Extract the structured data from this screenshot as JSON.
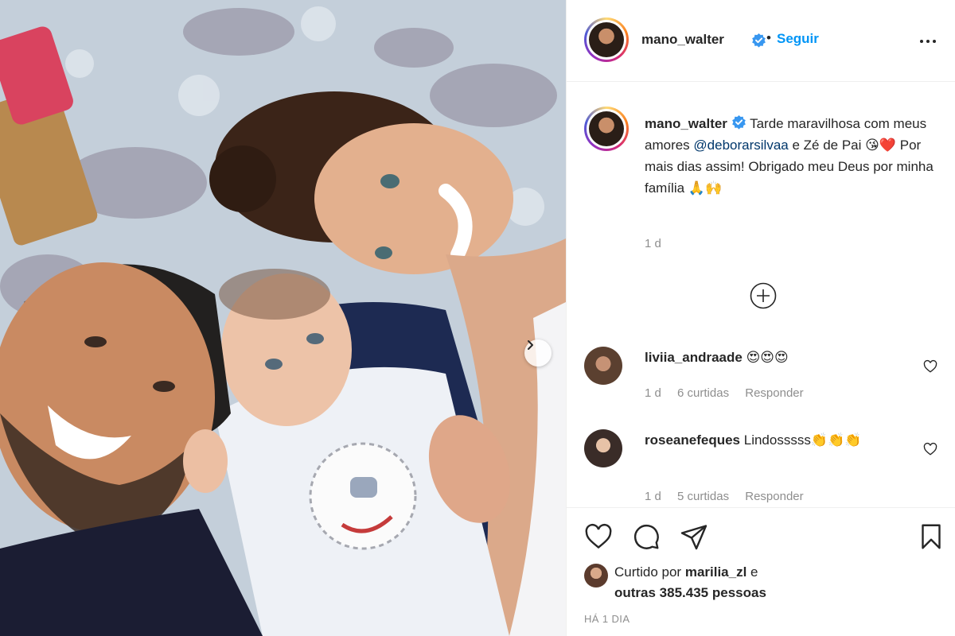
{
  "header": {
    "username": "mano_walter",
    "separator": "•",
    "follow_label": "Seguir",
    "more_icon": "more-horizontal-icon"
  },
  "caption": {
    "username": "mano_walter",
    "text_before_mention": "Tarde maravilhosa com meus amores ",
    "mention": "@deborarsilvaa",
    "text_after_mention": " e Zé de Pai 😘❤️ Por mais dias assim! Obrigado meu Deus por minha família 🙏🙌",
    "time": "1 d"
  },
  "load_more_icon": "plus-circle-icon",
  "comments": [
    {
      "username": "liviia_andraade",
      "text": "😍😍😍",
      "time": "1 d",
      "likes": "6 curtidas",
      "reply_label": "Responder"
    },
    {
      "username": "roseanefeques",
      "text": "Lindosssss👏👏👏",
      "time": "1 d",
      "likes": "5 curtidas",
      "reply_label": "Responder"
    }
  ],
  "actions": {
    "like_icon": "heart-icon",
    "comment_icon": "comment-icon",
    "share_icon": "send-icon",
    "save_icon": "bookmark-icon"
  },
  "likes": {
    "prefix": "Curtido por ",
    "user": "marilia_zl",
    "middle": " e",
    "others": "outras 385.435 pessoas"
  },
  "date": "HÁ 1 DIA",
  "colors": {
    "link_blue": "#0095f6",
    "mention_blue": "#00376b",
    "verified_blue": "#3897f0",
    "muted": "#8e8e8e",
    "text": "#262626"
  }
}
